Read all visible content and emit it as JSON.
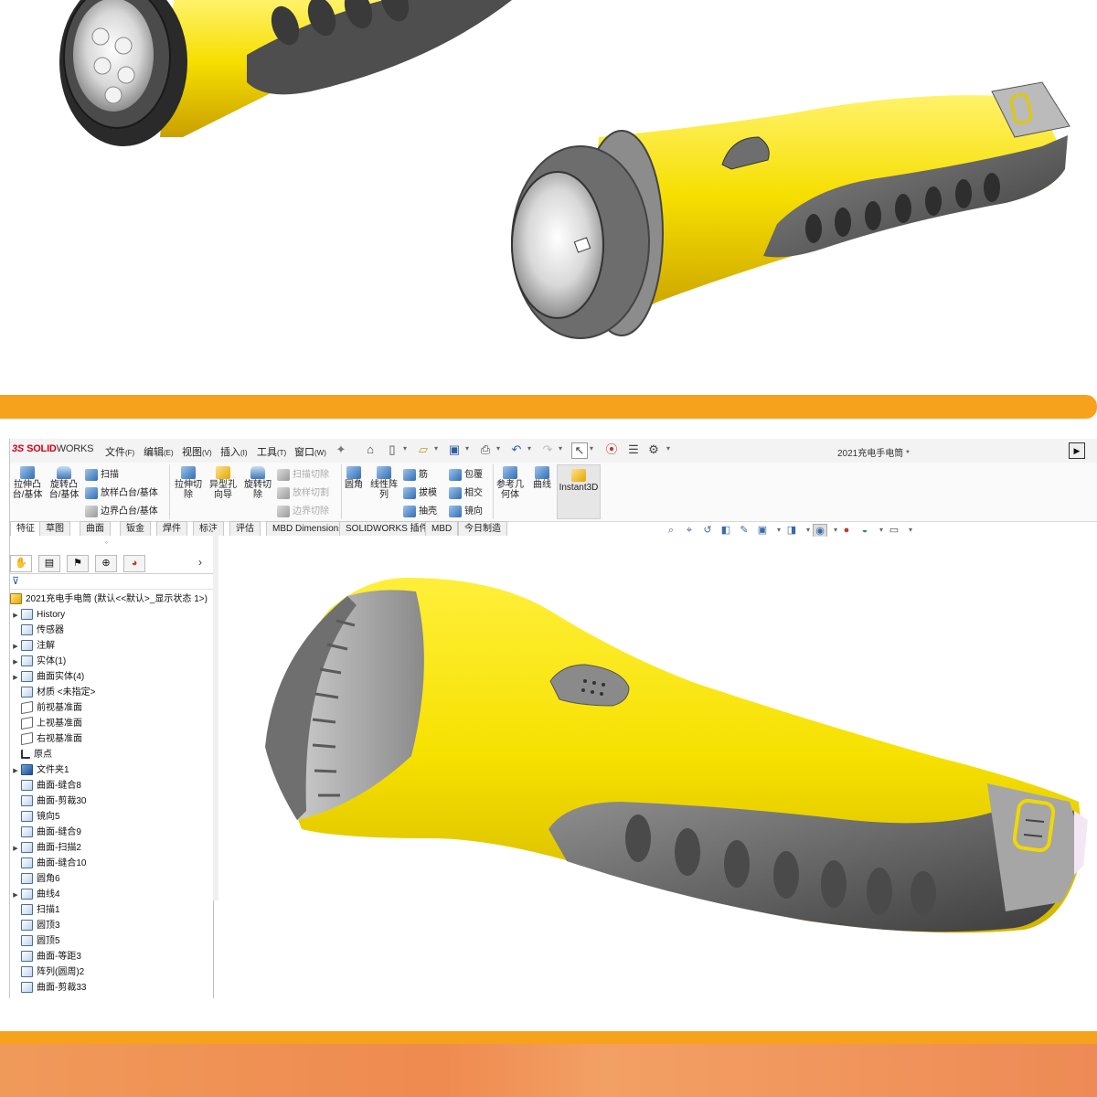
{
  "window": {
    "title": "2021充电手电筒 *",
    "logo": {
      "ds": "3S",
      "solid": "SOLID",
      "works": "WORKS"
    }
  },
  "menu": [
    {
      "label": "文件",
      "key": "(F)"
    },
    {
      "label": "编辑",
      "key": "(E)"
    },
    {
      "label": "视图",
      "key": "(V)"
    },
    {
      "label": "插入",
      "key": "(I)"
    },
    {
      "label": "工具",
      "key": "(T)"
    },
    {
      "label": "窗口",
      "key": "(W)"
    }
  ],
  "toolbar": {
    "extrude_boss": "拉伸凸台/基体",
    "revolve_boss": "旋转凸台/基体",
    "sweep": "扫描",
    "loft_boss": "放样凸台/基体",
    "boundary_boss": "边界凸台/基体",
    "extrude_cut": "拉伸切除",
    "hole_wizard": "异型孔向导",
    "revolve_cut": "旋转切除",
    "swept_cut": "扫描切除",
    "lofted_cut": "放样切割",
    "boundary_cut": "边界切除",
    "fillet": "圆角",
    "linear_pattern": "线性阵列",
    "rib": "筋",
    "draft": "拔模",
    "shell": "抽壳",
    "wrap": "包覆",
    "intersect": "相交",
    "mirror": "镜向",
    "ref_geometry": "参考几何体",
    "curves": "曲线",
    "instant3d": "Instant3D"
  },
  "tabs": [
    "特征",
    "草图",
    "曲面",
    "钣金",
    "焊件",
    "标注",
    "评估",
    "MBD Dimensions",
    "SOLIDWORKS 插件",
    "MBD",
    "今日制造"
  ],
  "tree": {
    "root": "2021充电手电筒  (默认<<默认>_显示状态 1>)",
    "items": [
      {
        "label": "History",
        "expand": true,
        "icon": "history-icon"
      },
      {
        "label": "传感器",
        "expand": false,
        "icon": "sensor-icon"
      },
      {
        "label": "注解",
        "expand": true,
        "icon": "annotation-icon"
      },
      {
        "label": "实体(1)",
        "expand": true,
        "icon": "solid-body-icon"
      },
      {
        "label": "曲面实体(4)",
        "expand": true,
        "icon": "surface-body-icon"
      },
      {
        "label": "材质 <未指定>",
        "expand": false,
        "icon": "material-icon"
      },
      {
        "label": "前视基准面",
        "expand": false,
        "icon": "plane-icon"
      },
      {
        "label": "上视基准面",
        "expand": false,
        "icon": "plane-icon"
      },
      {
        "label": "右视基准面",
        "expand": false,
        "icon": "plane-icon"
      },
      {
        "label": "原点",
        "expand": false,
        "icon": "origin-icon"
      },
      {
        "label": "文件夹1",
        "expand": true,
        "icon": "folder-icon"
      },
      {
        "label": "曲面-缝合8",
        "expand": false,
        "icon": "knit-icon"
      },
      {
        "label": "曲面-剪裁30",
        "expand": false,
        "icon": "trim-icon"
      },
      {
        "label": "镜向5",
        "expand": false,
        "icon": "mirror-icon"
      },
      {
        "label": "曲面-缝合9",
        "expand": false,
        "icon": "knit-icon"
      },
      {
        "label": "曲面-扫描2",
        "expand": true,
        "icon": "sweep-icon"
      },
      {
        "label": "曲面-缝合10",
        "expand": false,
        "icon": "knit-icon"
      },
      {
        "label": "圆角6",
        "expand": false,
        "icon": "fillet-icon"
      },
      {
        "label": "曲线4",
        "expand": true,
        "icon": "curve-icon"
      },
      {
        "label": "扫描1",
        "expand": false,
        "icon": "sweep-icon"
      },
      {
        "label": "圆顶3",
        "expand": false,
        "icon": "dome-icon"
      },
      {
        "label": "圆顶5",
        "expand": false,
        "icon": "dome-icon"
      },
      {
        "label": "曲面-等距3",
        "expand": false,
        "icon": "offset-icon"
      },
      {
        "label": "阵列(圆周)2",
        "expand": false,
        "icon": "pattern-icon"
      },
      {
        "label": "曲面-剪裁33",
        "expand": false,
        "icon": "trim-icon"
      }
    ]
  },
  "colors": {
    "accent_orange": "#f7a21c",
    "body_yellow": "#f5e100",
    "grip_grey": "#4a4a4a"
  }
}
